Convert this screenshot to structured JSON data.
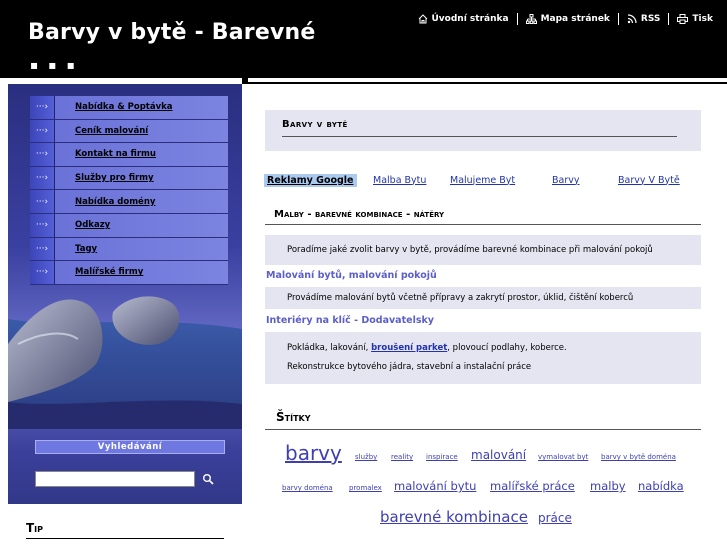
{
  "header": {
    "site_title": "Barvy v bytě - Barevné",
    "title_dots": "▪  ▪ ▪",
    "nav": [
      {
        "label": "Úvodní stránka",
        "icon": "home-icon"
      },
      {
        "label": "Mapa stránek",
        "icon": "sitemap-icon"
      },
      {
        "label": "RSS",
        "icon": "rss-icon"
      },
      {
        "label": "Tisk",
        "icon": "print-icon"
      }
    ]
  },
  "sidebar": {
    "menu": [
      {
        "label": "Nabídka & Poptávka"
      },
      {
        "label": "Ceník malování"
      },
      {
        "label": "Kontakt na firmu"
      },
      {
        "label": "Služby pro firmy"
      },
      {
        "label": "Nabídka domény"
      },
      {
        "label": "Odkazy"
      },
      {
        "label": "Tagy"
      },
      {
        "label": "Malířské firmy"
      }
    ],
    "search_title": "Vyhledávání",
    "search_placeholder": "",
    "tip_title": "Tip"
  },
  "main": {
    "page_title": "Barvy v bytě",
    "ads": {
      "label": "Reklamy Google",
      "links": [
        "Malba Bytu",
        "Malujeme Byt",
        "Barvy",
        "Barvy V Bytě"
      ]
    },
    "section_heading": "Malby - barevné kombinace - nátěry",
    "intro_text": "Poradíme jaké zvolit barvy v bytě, provádíme barevné kombinace při malování pokojů",
    "sub1_title": "Malování bytů, malování pokojů",
    "sub1_text": "Provádíme malování bytů včetně přípravy a zakrytí prostor, úklid, čištění koberců",
    "sub2_title": "Interiéry na klíč - Dodavatelsky",
    "sub2_text_before": "Pokládka, lakování,",
    "sub2_link": "broušení parket",
    "sub2_text_after": ", plovoucí podlahy, koberce.",
    "sub2_text2": "Rekonstrukce bytového jádra, stavební a instalační práce",
    "tags_heading": "Štítky",
    "tags": [
      {
        "label": "barvy"
      },
      {
        "label": "služby"
      },
      {
        "label": "reality"
      },
      {
        "label": "inspirace"
      },
      {
        "label": "malování"
      },
      {
        "label": "vymalovat byt"
      },
      {
        "label": "barvy v bytě doména"
      },
      {
        "label": "barvy doména"
      },
      {
        "label": "promalex"
      },
      {
        "label": "malování bytu"
      },
      {
        "label": "malířské práce"
      },
      {
        "label": "malby"
      },
      {
        "label": "nabídka"
      },
      {
        "label": "barevné kombinace"
      },
      {
        "label": "práce"
      }
    ]
  },
  "colors": {
    "header_bg": "#000000",
    "sidebar_blue": "#3a40a0",
    "menu_label_bg": "#7c84e0",
    "content_band": "#e4e5f1",
    "link": "#2233aa",
    "tag": "#3d3fb3",
    "sublink": "#5b5fc7",
    "ads_label_bg": "#aacaf0"
  }
}
